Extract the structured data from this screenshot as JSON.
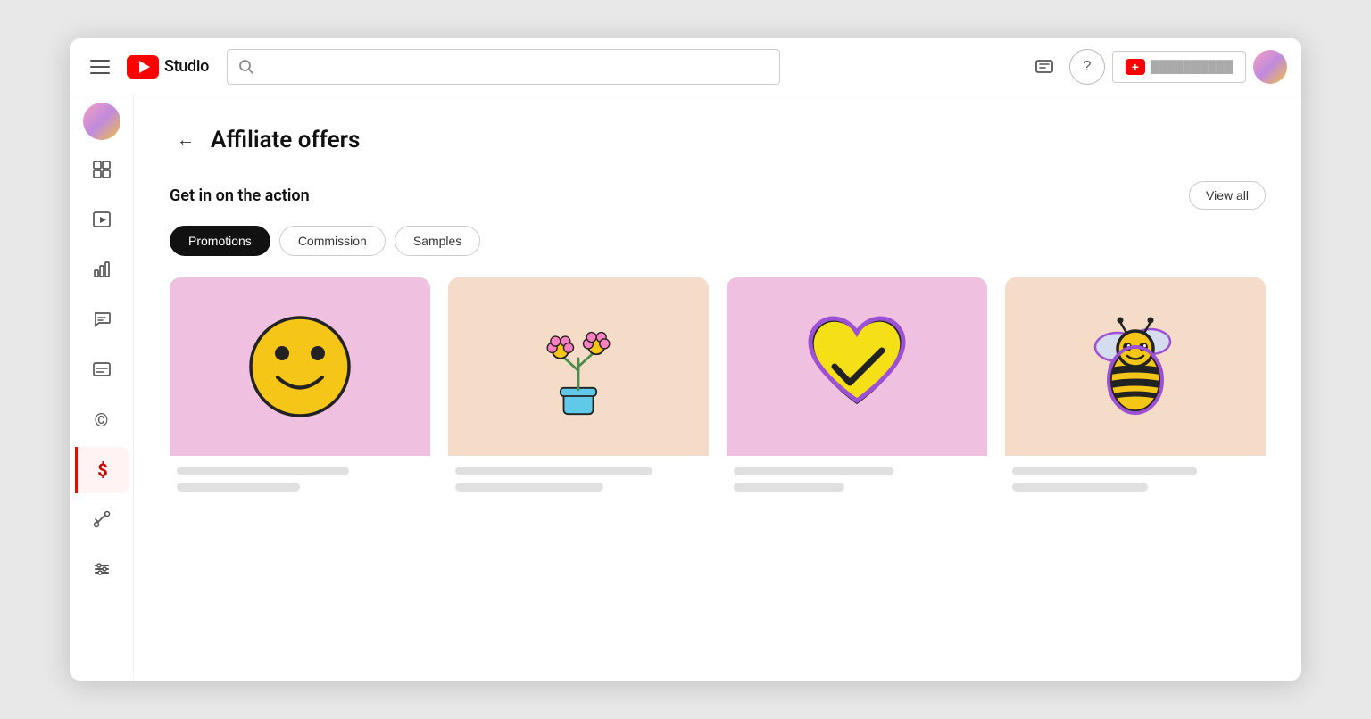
{
  "header": {
    "menu_label": "Menu",
    "logo_text": "Studio",
    "search_placeholder": "",
    "create_button_text": "",
    "help_icon": "?",
    "messages_icon": "💬"
  },
  "sidebar": {
    "items": [
      {
        "id": "avatar",
        "icon": "👤",
        "label": "Channel"
      },
      {
        "id": "dashboard",
        "icon": "⊞",
        "label": "Dashboard"
      },
      {
        "id": "content",
        "icon": "▶",
        "label": "Content"
      },
      {
        "id": "analytics",
        "icon": "📊",
        "label": "Analytics"
      },
      {
        "id": "comments",
        "icon": "💬",
        "label": "Comments"
      },
      {
        "id": "subtitles",
        "icon": "📋",
        "label": "Subtitles"
      },
      {
        "id": "copyright",
        "icon": "©",
        "label": "Copyright"
      },
      {
        "id": "monetization",
        "icon": "$",
        "label": "Monetization",
        "active": true
      },
      {
        "id": "customization",
        "icon": "✨",
        "label": "Customization"
      },
      {
        "id": "settings",
        "icon": "⊟",
        "label": "Settings"
      }
    ]
  },
  "page": {
    "back_label": "←",
    "title": "Affiliate offers",
    "section_title": "Get in on the action",
    "view_all_label": "View all",
    "tabs": [
      {
        "id": "promotions",
        "label": "Promotions",
        "active": true
      },
      {
        "id": "commission",
        "label": "Commission",
        "active": false
      },
      {
        "id": "samples",
        "label": "Samples",
        "active": false
      }
    ],
    "cards": [
      {
        "id": "card1",
        "bg": "pink",
        "sticker": "smiley",
        "bar1_width": "70%",
        "bar2_width": "50%"
      },
      {
        "id": "card2",
        "bg": "peach",
        "sticker": "flower",
        "bar1_width": "80%",
        "bar2_width": "60%"
      },
      {
        "id": "card3",
        "bg": "pink",
        "sticker": "heart",
        "bar1_width": "65%",
        "bar2_width": "45%"
      },
      {
        "id": "card4",
        "bg": "peach",
        "sticker": "bee",
        "bar1_width": "75%",
        "bar2_width": "55%"
      }
    ]
  }
}
